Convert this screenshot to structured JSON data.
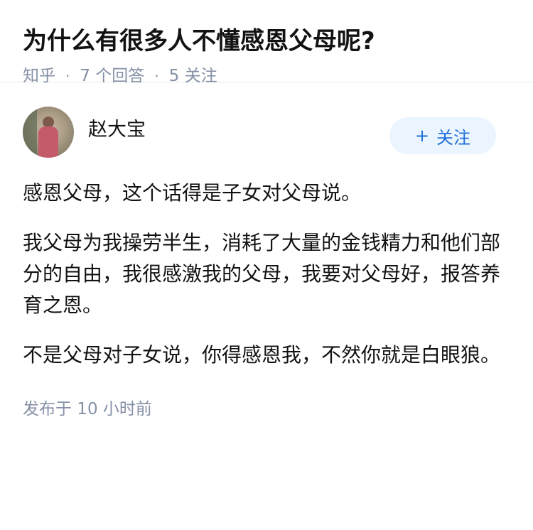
{
  "question": {
    "title": "为什么有很多人不懂感恩父母呢?",
    "source": "知乎",
    "answers_count": "7 个回答",
    "followers_count": "5 关注"
  },
  "answer": {
    "author_name": "赵大宝",
    "follow_button": {
      "icon": "plus-icon",
      "plus": "+",
      "label": "关注"
    },
    "paragraphs": [
      "感恩父母，这个话得是子女对父母说。",
      "我父母为我操劳半生，消耗了大量的金钱精力和他们部分的自由，我很感激我的父母，我要对父母好，报答养育之恩。",
      "不是父母对子女说，你得感恩我，不然你就是白眼狼。"
    ],
    "published": "发布于 10 小时前"
  }
}
